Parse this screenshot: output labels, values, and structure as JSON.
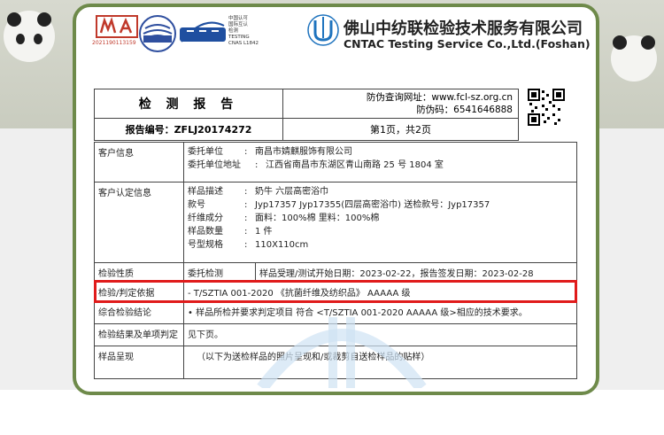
{
  "header": {
    "cma_caption": "2021190113159",
    "cnas_lines": [
      "中国认可",
      "国际互认",
      "检测",
      "TESTING",
      "CNAS L1842"
    ],
    "company_cn": "佛山中纺联检验技术服务有限公司",
    "company_en": "CNTAC Testing Service Co.,Ltd.(Foshan)"
  },
  "report": {
    "title": "检 测 报 告",
    "verify_label": "防伪查询网址：www.fcl-sz.org.cn",
    "code_label": "防伪码：6541646888",
    "number": "报告编号：ZFLJ20174272",
    "page": "第1页，共2页"
  },
  "rows": {
    "client_label": "客户信息",
    "client": [
      {
        "k": "委托单位",
        "v": "南昌市婧麒服饰有限公司"
      },
      {
        "k": "委托单位地址",
        "v": "江西省南昌市东湖区青山南路 25 号 1804 室"
      }
    ],
    "confirm_label": "客户认定信息",
    "confirm": [
      {
        "k": "样品描述",
        "v": "奶牛 六层高密浴巾"
      },
      {
        "k": "款号",
        "v": "Jyp17357 Jyp17355(四层高密浴巾) 送检款号：Jyp17357"
      },
      {
        "k": "纤维成分",
        "v": "面料：100%棉 里料：100%棉"
      },
      {
        "k": "样品数量",
        "v": "1 件"
      },
      {
        "k": "号型规格",
        "v": "110X110cm"
      }
    ],
    "nature_label": "检验性质",
    "nature_value": "委托检测",
    "nature_dates": "样品受理/测试开始日期：2023-02-22，报告签发日期：2023-02-28",
    "basis_label": "检验/判定依据",
    "basis_value": "- T/SZTIA 001-2020 《抗菌纤维及纺织品》 AAAAA 级",
    "conclusion_label": "综合检验结论",
    "conclusion_value": "• 样品所检并要求判定项目 符合 <T/SZTIA 001-2020 AAAAA 级>相应的技术要求。",
    "result_label": "检验结果及单项判定",
    "result_value": "见下页。",
    "photo_label": "样品呈现",
    "photo_value": "（以下为送检样品的照片呈现和/或裁剪自送检样品的贴样）"
  }
}
